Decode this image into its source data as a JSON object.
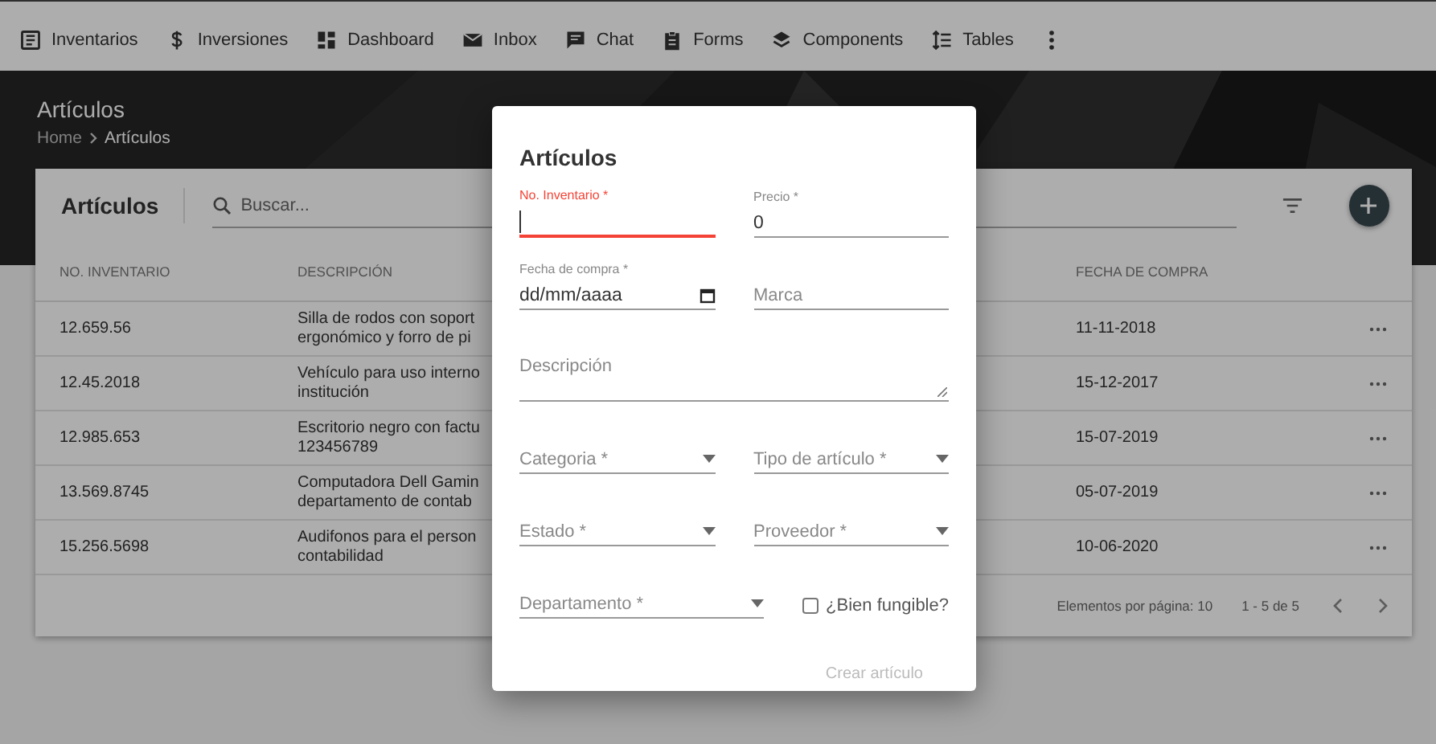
{
  "nav": {
    "items": [
      {
        "label": "Inventarios"
      },
      {
        "label": "Inversiones"
      },
      {
        "label": "Dashboard"
      },
      {
        "label": "Inbox"
      },
      {
        "label": "Chat"
      },
      {
        "label": "Forms"
      },
      {
        "label": "Components"
      },
      {
        "label": "Tables"
      }
    ]
  },
  "header": {
    "title": "Artículos",
    "breadcrumb": [
      {
        "label": "Home"
      },
      {
        "label": "Artículos"
      }
    ]
  },
  "card": {
    "title": "Artículos",
    "search": {
      "placeholder": "Buscar..."
    },
    "table": {
      "columns": [
        "NO. INVENTARIO",
        "DESCRIPCIÓN",
        "FECHA DE COMPRA"
      ],
      "rows": [
        {
          "inventory": "12.659.56",
          "description": [
            "Silla de rodos con soport",
            "ergonómico y forro de pi"
          ],
          "date": "11-11-2018"
        },
        {
          "inventory": "12.45.2018",
          "description": [
            "Vehículo para uso interno",
            "institución"
          ],
          "date": "15-12-2017"
        },
        {
          "inventory": "12.985.653",
          "description": [
            "Escritorio negro con factu",
            "123456789"
          ],
          "date": "15-07-2019"
        },
        {
          "inventory": "13.569.8745",
          "description": [
            "Computadora Dell Gamin",
            "departamento de contab"
          ],
          "date": "05-07-2019"
        },
        {
          "inventory": "15.256.5698",
          "description": [
            "Audifonos para el person",
            "contabilidad"
          ],
          "date": "10-06-2020"
        }
      ]
    },
    "paginator": {
      "page_size_label": "Elementos por página: 10",
      "range": "1 - 5 de 5"
    }
  },
  "dialog": {
    "title": "Artículos",
    "rows": [
      [
        {
          "kind": "text",
          "label": "No. Inventario *",
          "focused": true
        },
        {
          "kind": "text",
          "label": "Precio *",
          "value": "0",
          "focused": false
        }
      ],
      [
        {
          "kind": "date",
          "label": "Fecha de compra *",
          "placeholder": "dd/mm/aaaa",
          "focused": false
        },
        {
          "kind": "text",
          "label": "Marca",
          "focused": false
        }
      ],
      [
        {
          "kind": "textarea",
          "label": "Descripción",
          "focused": false
        }
      ],
      [
        {
          "kind": "select",
          "label": "Categoria *",
          "focused": false
        },
        {
          "kind": "select",
          "label": "Tipo de artículo *",
          "focused": false
        }
      ],
      [
        {
          "kind": "select",
          "label": "Estado *",
          "focused": false
        },
        {
          "kind": "select",
          "label": "Proveedor *",
          "focused": false
        }
      ],
      [
        {
          "kind": "select",
          "label": "Departamento *",
          "focused": false
        },
        {
          "kind": "checkbox",
          "label": "¿Bien fungible?",
          "checked": false
        }
      ]
    ],
    "submit": {
      "label": "Crear artículo",
      "disabled": true
    }
  }
}
